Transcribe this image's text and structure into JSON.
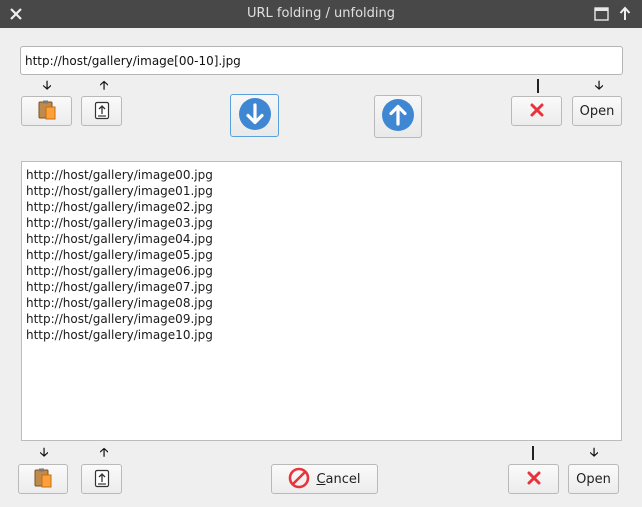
{
  "window": {
    "title": "URL folding / unfolding"
  },
  "titlebar": {
    "close_icon": "close-icon",
    "maximize_icon": "maximize-icon",
    "keep_above_icon": "pin-up-icon"
  },
  "top": {
    "url_value": "http://host/gallery/image[00-10].jpg",
    "paste_icon": "clipboard-paste-icon",
    "copy_icon": "clipboard-copy-icon",
    "expand_icon": "arrow-down-circle-icon",
    "fold_icon": "arrow-up-circle-icon",
    "clear_icon": "red-x-icon",
    "open_label": "Open"
  },
  "list": {
    "lines": [
      "http://host/gallery/image00.jpg",
      "http://host/gallery/image01.jpg",
      "http://host/gallery/image02.jpg",
      "http://host/gallery/image03.jpg",
      "http://host/gallery/image04.jpg",
      "http://host/gallery/image05.jpg",
      "http://host/gallery/image06.jpg",
      "http://host/gallery/image07.jpg",
      "http://host/gallery/image08.jpg",
      "http://host/gallery/image09.jpg",
      "http://host/gallery/image10.jpg"
    ]
  },
  "bottom": {
    "cancel_prefix": "",
    "cancel_mnemonic": "C",
    "cancel_rest": "ancel",
    "open_label": "Open"
  },
  "colors": {
    "accent": "#3f87d3",
    "danger": "#e8323c",
    "titlebar": "#484848"
  }
}
